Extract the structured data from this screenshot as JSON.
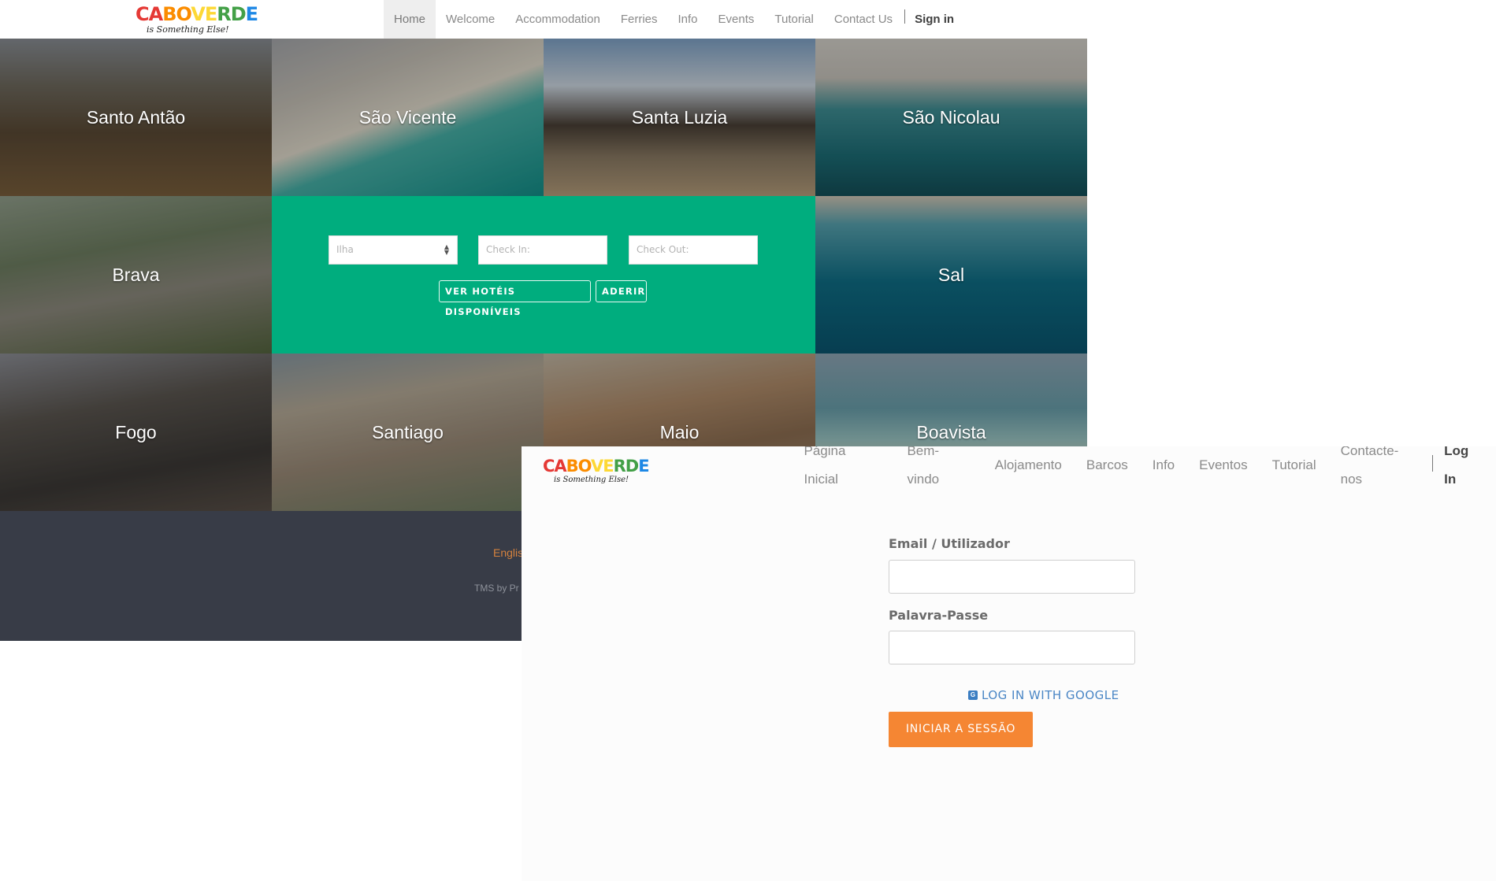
{
  "colors": {
    "search_panel": "#00ad7e",
    "footer_bg": "#383c47",
    "accent_orange": "#f58633",
    "google_link": "#4a86c5"
  },
  "back_page": {
    "logo": {
      "main_letters": [
        "CA",
        "BO",
        "VE",
        "RD",
        "E"
      ],
      "tagline": "is Something Else!"
    },
    "nav": {
      "items": [
        "Home",
        "Welcome",
        "Accommodation",
        "Ferries",
        "Info",
        "Events",
        "Tutorial",
        "Contact Us"
      ],
      "active": "Home",
      "signin": "Sign in"
    },
    "islands": [
      "Santo Antão",
      "São Vicente",
      "Santa Luzia",
      "São Nicolau",
      "Brava",
      "Sal",
      "Fogo",
      "Santiago",
      "Maio",
      "Boavista"
    ],
    "search": {
      "island_placeholder": "Ilha",
      "checkin_placeholder": "Check In:",
      "checkout_placeholder": "Check Out:",
      "hotels_button": "VER HOTÉIS DISPONÍVEIS",
      "join_button": "ADERIR"
    },
    "footer": {
      "language_link": "Englis",
      "credit": "TMS by Pr"
    }
  },
  "login_page": {
    "logo": {
      "main_letters": [
        "CA",
        "BO",
        "VE",
        "RD",
        "E"
      ],
      "tagline": "is Something Else!"
    },
    "nav": {
      "items": [
        "Página Inicial",
        "Bem-vindo",
        "Alojamento",
        "Barcos",
        "Info",
        "Eventos",
        "Tutorial",
        "Contacte-nos"
      ],
      "login": "Log In"
    },
    "form": {
      "email_label": "Email / Utilizador",
      "password_label": "Palavra-Passe",
      "google_link": "LOG IN WITH GOOGLE",
      "google_icon": "google-icon",
      "submit_button": "INICIAR A SESSÃO"
    }
  }
}
